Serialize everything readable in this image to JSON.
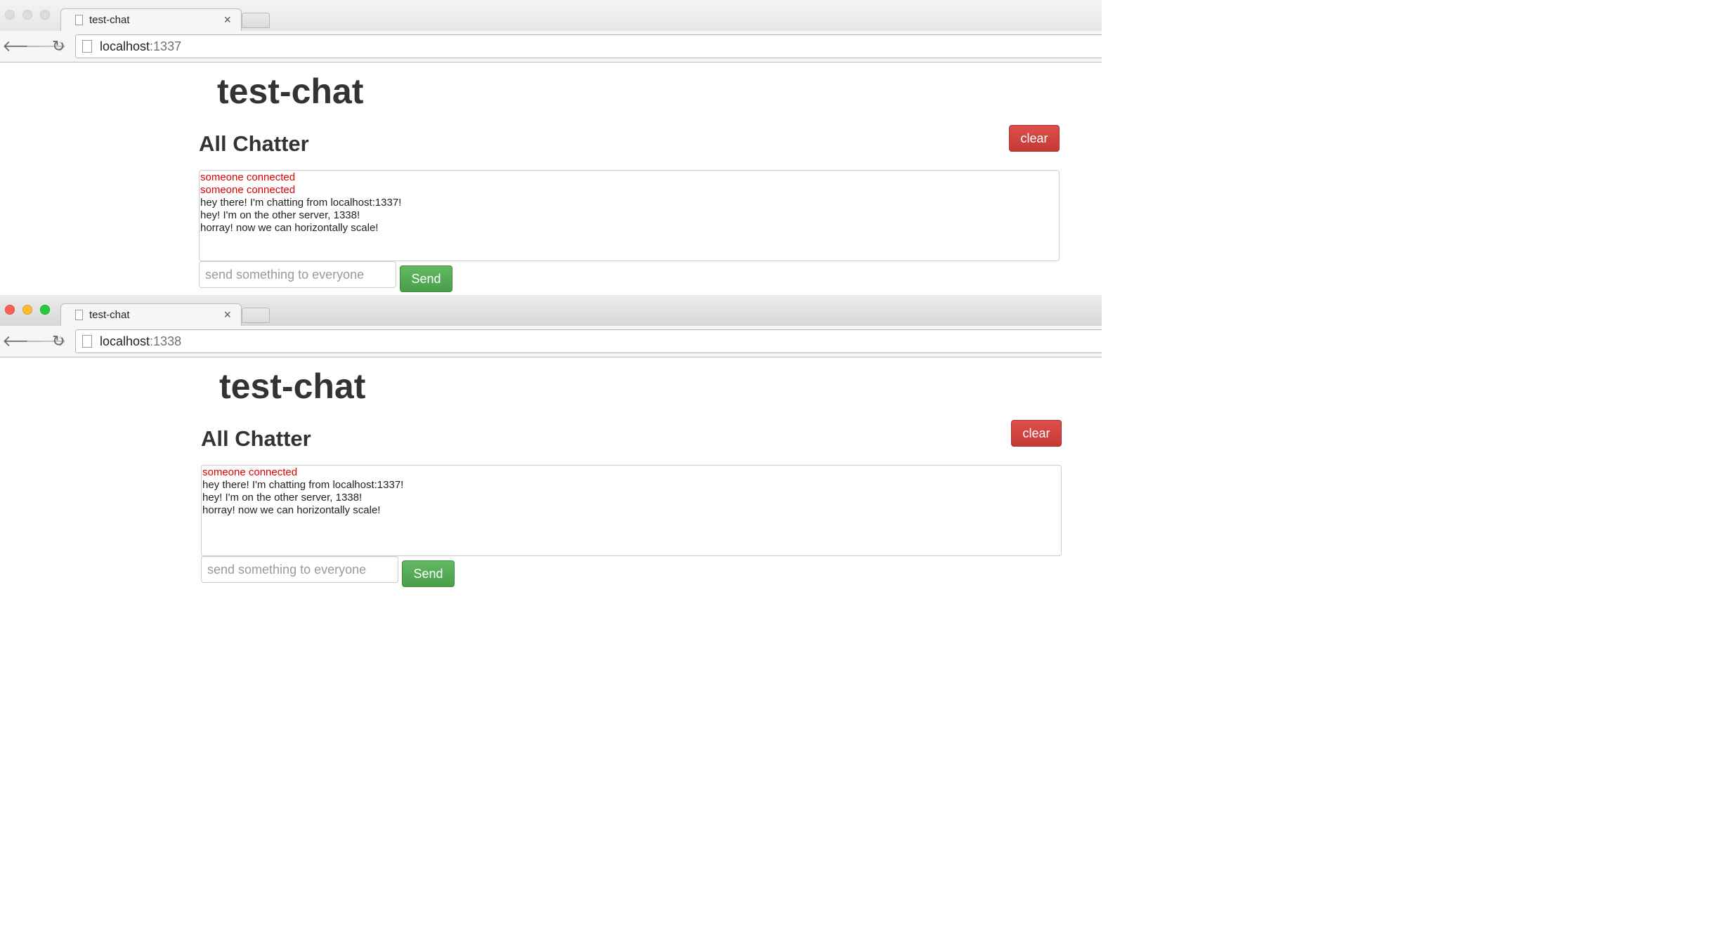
{
  "windows": [
    {
      "tab_title": "test-chat",
      "tab_close": "×",
      "url_host": "localhost",
      "url_port": ":1337",
      "app_title": "test-chat",
      "section_title": "All Chatter",
      "clear_label": "clear",
      "messages": [
        {
          "text": "someone connected",
          "type": "system"
        },
        {
          "text": "someone connected",
          "type": "system"
        },
        {
          "text": "hey there! I'm chatting from localhost:1337!",
          "type": "chat"
        },
        {
          "text": "hey! I'm on the other server, 1338!",
          "type": "chat"
        },
        {
          "text": "horray! now we can horizontally scale!",
          "type": "chat"
        }
      ],
      "input_placeholder": "send something to everyone",
      "send_label": "Send"
    },
    {
      "tab_title": "test-chat",
      "tab_close": "×",
      "url_host": "localhost",
      "url_port": ":1338",
      "app_title": "test-chat",
      "section_title": "All Chatter",
      "clear_label": "clear",
      "messages": [
        {
          "text": "someone connected",
          "type": "system"
        },
        {
          "text": "hey there! I'm chatting from localhost:1337!",
          "type": "chat"
        },
        {
          "text": "hey! I'm on the other server, 1338!",
          "type": "chat"
        },
        {
          "text": "horray! now we can horizontally scale!",
          "type": "chat"
        }
      ],
      "input_placeholder": "send something to everyone",
      "send_label": "Send"
    }
  ],
  "icons": {
    "back": "🡐",
    "forward": "🡒",
    "reload": "↻"
  },
  "colors": {
    "system_message": "#e00000",
    "clear_button": "#d9534f",
    "send_button": "#5cb85c"
  }
}
